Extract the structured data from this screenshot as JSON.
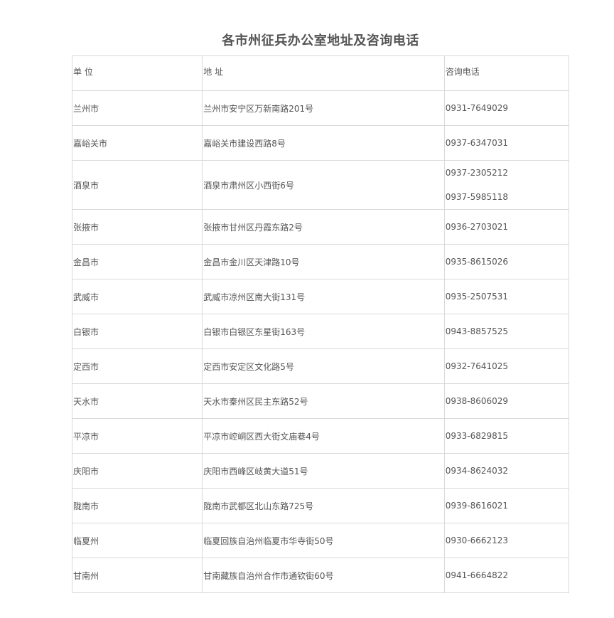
{
  "title": "各市州征兵办公室地址及咨询电话",
  "headers": {
    "unit": "单 位",
    "address": "地 址",
    "phone": "咨询电话"
  },
  "rows": [
    {
      "unit": "兰州市",
      "address": "兰州市安宁区万新南路201号",
      "phones": [
        "0931-7649029"
      ]
    },
    {
      "unit": "嘉峪关市",
      "address": "嘉峪关市建设西路8号",
      "phones": [
        "0937-6347031"
      ]
    },
    {
      "unit": "酒泉市",
      "address": "酒泉市肃州区小西街6号",
      "phones": [
        "0937-2305212",
        "0937-5985118"
      ]
    },
    {
      "unit": "张掖市",
      "address": "张掖市甘州区丹霞东路2号",
      "phones": [
        "0936-2703021"
      ]
    },
    {
      "unit": "金昌市",
      "address": "金昌市金川区天津路10号",
      "phones": [
        "0935-8615026"
      ]
    },
    {
      "unit": "武威市",
      "address": "武威市凉州区南大街131号",
      "phones": [
        "0935-2507531"
      ]
    },
    {
      "unit": "白银市",
      "address": "白银市白银区东星街163号",
      "phones": [
        "0943-8857525"
      ]
    },
    {
      "unit": "定西市",
      "address": "定西市安定区文化路5号",
      "phones": [
        "0932-7641025"
      ]
    },
    {
      "unit": "天水市",
      "address": "天水市秦州区民主东路52号",
      "phones": [
        "0938-8606029"
      ]
    },
    {
      "unit": "平凉市",
      "address": "平凉市崆峒区西大街文庙巷4号",
      "phones": [
        "0933-6829815"
      ]
    },
    {
      "unit": "庆阳市",
      "address": "庆阳市西峰区岐黄大道51号",
      "phones": [
        "0934-8624032"
      ]
    },
    {
      "unit": "陇南市",
      "address": "陇南市武都区北山东路725号",
      "phones": [
        "0939-8616021"
      ]
    },
    {
      "unit": "临夏州",
      "address": "临夏回族自治州临夏市华寺街50号",
      "phones": [
        "0930-6662123"
      ]
    },
    {
      "unit": "甘南州",
      "address": "甘南藏族自治州合作市通钦街60号",
      "phones": [
        "0941-6664822"
      ]
    }
  ],
  "colors": {
    "text": "#555555",
    "border": "#d9d9d9",
    "background": "#ffffff"
  }
}
